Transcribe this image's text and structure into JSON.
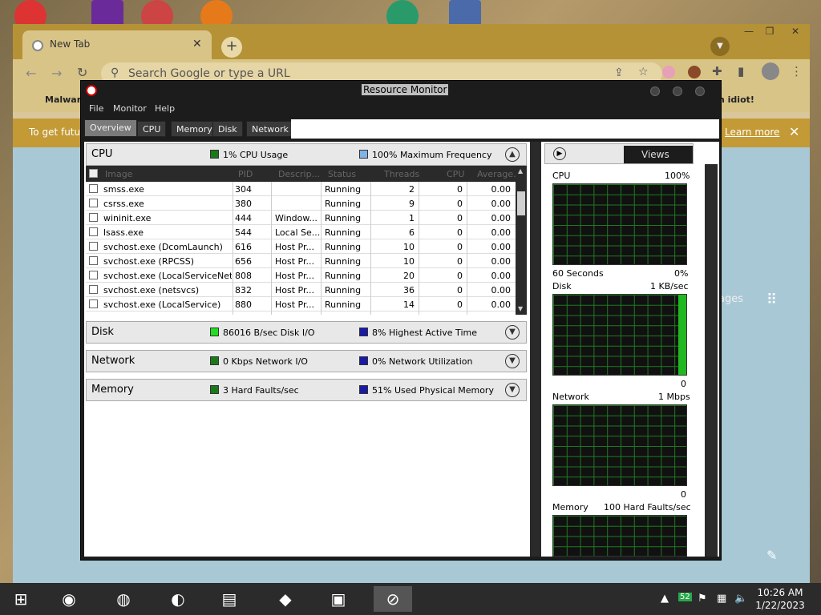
{
  "chrome": {
    "tab_title": "New Tab",
    "tab_close": "✕",
    "new_tab": "+",
    "omnibox_placeholder": "Search Google or type a URL",
    "bookmark_1": "Malware",
    "bookmark_2": "n idiot!",
    "infobar_text": "To get futu",
    "learn_more": "Learn more",
    "info_close": "✕",
    "images": "ages",
    "window_min": "—",
    "window_max": "❐",
    "window_close": "✕"
  },
  "resmon": {
    "title": "Resource Monitor",
    "menus": [
      "File",
      "Monitor",
      "Help"
    ],
    "tabs": [
      "Overview",
      "CPU",
      "Memory",
      "Disk",
      "Network"
    ],
    "cpu": {
      "name": "CPU",
      "stat1": "1% CPU Usage",
      "stat2": "100% Maximum Frequency",
      "color1": "#1a7a1a",
      "color2": "#7fb2e6"
    },
    "columns": [
      "Image",
      "PID",
      "Descrip...",
      "Status",
      "Threads",
      "CPU",
      "Average..."
    ],
    "processes": [
      {
        "image": "smss.exe",
        "pid": "304",
        "desc": "",
        "status": "Running",
        "threads": "2",
        "cpu": "0",
        "avg": "0.00"
      },
      {
        "image": "csrss.exe",
        "pid": "380",
        "desc": "",
        "status": "Running",
        "threads": "9",
        "cpu": "0",
        "avg": "0.00"
      },
      {
        "image": "wininit.exe",
        "pid": "444",
        "desc": "Window...",
        "status": "Running",
        "threads": "1",
        "cpu": "0",
        "avg": "0.00"
      },
      {
        "image": "lsass.exe",
        "pid": "544",
        "desc": "Local Se...",
        "status": "Running",
        "threads": "6",
        "cpu": "0",
        "avg": "0.00"
      },
      {
        "image": "svchost.exe (DcomLaunch)",
        "pid": "616",
        "desc": "Host Pr...",
        "status": "Running",
        "threads": "10",
        "cpu": "0",
        "avg": "0.00"
      },
      {
        "image": "svchost.exe (RPCSS)",
        "pid": "656",
        "desc": "Host Pr...",
        "status": "Running",
        "threads": "10",
        "cpu": "0",
        "avg": "0.00"
      },
      {
        "image": "svchost.exe (LocalServiceNetw...",
        "pid": "808",
        "desc": "Host Pr...",
        "status": "Running",
        "threads": "20",
        "cpu": "0",
        "avg": "0.00"
      },
      {
        "image": "svchost.exe (netsvcs)",
        "pid": "832",
        "desc": "Host Pr...",
        "status": "Running",
        "threads": "36",
        "cpu": "0",
        "avg": "0.00"
      },
      {
        "image": "svchost.exe (LocalService)",
        "pid": "880",
        "desc": "Host Pr...",
        "status": "Running",
        "threads": "14",
        "cpu": "0",
        "avg": "0.00"
      }
    ],
    "disk": {
      "name": "Disk",
      "stat1": "86016 B/sec Disk I/O",
      "stat2": "8% Highest Active Time",
      "color1": "#22dd22",
      "color2": "#1a1aa8"
    },
    "network": {
      "name": "Network",
      "stat1": "0 Kbps Network I/O",
      "stat2": "0% Network Utilization",
      "color1": "#1a7a1a",
      "color2": "#1a1aa8"
    },
    "memory": {
      "name": "Memory",
      "stat1": "3 Hard Faults/sec",
      "stat2": "51% Used Physical Memory",
      "color1": "#1a7a1a",
      "color2": "#1a1aa8"
    },
    "views_label": "Views",
    "graphs": {
      "cpu": {
        "label": "CPU",
        "max": "100%",
        "bottom_left": "60 Seconds",
        "bottom_right": "0%"
      },
      "disk": {
        "label": "Disk",
        "max": "1 KB/sec",
        "bottom_right": "0"
      },
      "network": {
        "label": "Network",
        "max": "1 Mbps",
        "bottom_right": "0"
      },
      "memory": {
        "label": "Memory",
        "max": "100 Hard Faults/sec"
      }
    }
  },
  "taskbar": {
    "time": "10:26 AM",
    "date": "1/22/2023",
    "tray_badge": "52"
  }
}
